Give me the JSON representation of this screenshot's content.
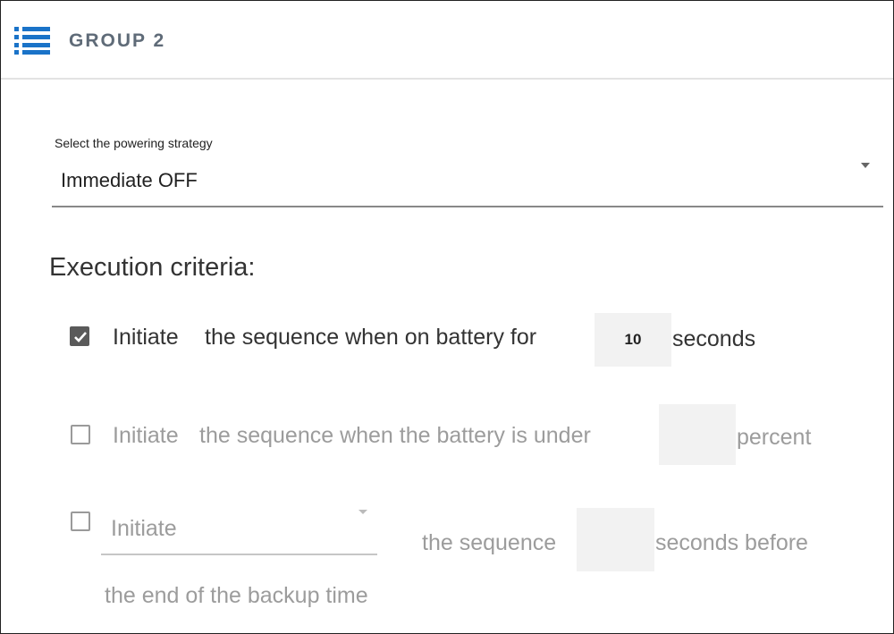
{
  "header": {
    "title": "GROUP 2",
    "icon": "menu-icon"
  },
  "strategy": {
    "label": "Select the powering strategy",
    "value": "Immediate OFF"
  },
  "criteria": {
    "title": "Execution criteria:",
    "row1": {
      "checked": true,
      "prefix": "Initiate",
      "text": "the sequence when on battery for",
      "value": "10",
      "suffix": "seconds"
    },
    "row2": {
      "checked": false,
      "prefix": "Initiate",
      "text": "the sequence when the battery is under",
      "value": "",
      "suffix": "percent"
    },
    "row3": {
      "checked": false,
      "dropdown_value": "Initiate",
      "text": "the sequence",
      "value": "",
      "suffix": "seconds before",
      "line2": "the end of the backup time"
    }
  },
  "colors": {
    "accent": "#1a73c8",
    "checkbox_checked": "#5a5a5a",
    "disabled_text": "#9c9c9c"
  }
}
